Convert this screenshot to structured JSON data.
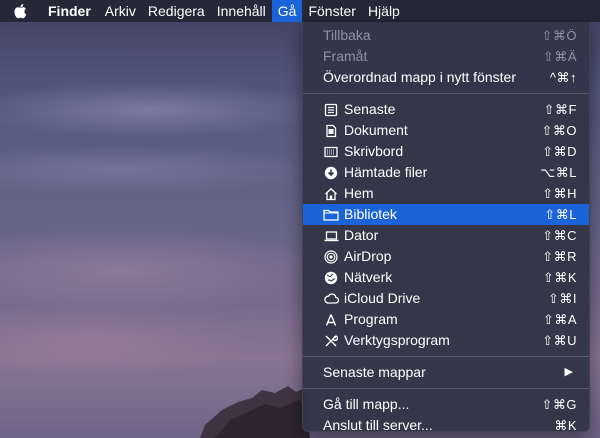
{
  "menubar": {
    "finder": "Finder",
    "arkiv": "Arkiv",
    "redigera": "Redigera",
    "innehall": "Innehåll",
    "ga": "Gå",
    "fonster": "Fönster",
    "hjalp": "Hjälp"
  },
  "menu": {
    "back": {
      "label": "Tillbaka",
      "shortcut": "⇧⌘Ö"
    },
    "forward": {
      "label": "Framåt",
      "shortcut": "⇧⌘Ä"
    },
    "enclosing": {
      "label": "Överordnad mapp i nytt fönster",
      "shortcut": "^⌘↑"
    },
    "recents": {
      "label": "Senaste",
      "shortcut": "⇧⌘F"
    },
    "documents": {
      "label": "Dokument",
      "shortcut": "⇧⌘O"
    },
    "desktop": {
      "label": "Skrivbord",
      "shortcut": "⇧⌘D"
    },
    "downloads": {
      "label": "Hämtade filer",
      "shortcut": "⌥⌘L"
    },
    "home": {
      "label": "Hem",
      "shortcut": "⇧⌘H"
    },
    "library": {
      "label": "Bibliotek",
      "shortcut": "⇧⌘L"
    },
    "computer": {
      "label": "Dator",
      "shortcut": "⇧⌘C"
    },
    "airdrop": {
      "label": "AirDrop",
      "shortcut": "⇧⌘R"
    },
    "network": {
      "label": "Nätverk",
      "shortcut": "⇧⌘K"
    },
    "icloud": {
      "label": "iCloud Drive",
      "shortcut": "⇧⌘I"
    },
    "applications": {
      "label": "Program",
      "shortcut": "⇧⌘A"
    },
    "utilities": {
      "label": "Verktygsprogram",
      "shortcut": "⇧⌘U"
    },
    "recent_folders": {
      "label": "Senaste mappar"
    },
    "go_to_folder": {
      "label": "Gå till mapp...",
      "shortcut": "⇧⌘G"
    },
    "connect_server": {
      "label": "Anslut till server...",
      "shortcut": "⌘K"
    }
  },
  "colors": {
    "highlight": "#1a64d8",
    "menu_bg": "#343548",
    "disabled_text": "#8f90a3"
  }
}
